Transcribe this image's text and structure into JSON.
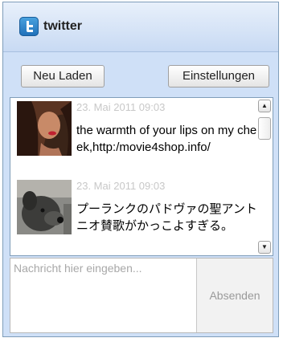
{
  "app": {
    "title": "twitter",
    "logo_icon": "twitter-bird-icon",
    "accent_color": "#cfe0f7"
  },
  "toolbar": {
    "reload_label": "Neu Laden",
    "settings_label": "Einstellungen"
  },
  "feed": {
    "tweets": [
      {
        "date": "23. Mai 2011 09:03",
        "text": "the warmth of your lips on my cheek,http:/movie4shop.info/",
        "avatar_icon": "user-avatar-woman"
      },
      {
        "date": "23. Mai 2011 09:03",
        "text": "プーランクのパドヴァの聖アントニオ賛歌がかっこよすぎる。",
        "avatar_icon": "user-avatar-dog"
      }
    ]
  },
  "composer": {
    "placeholder": "Nachricht hier eingeben...",
    "send_label": "Absenden"
  }
}
